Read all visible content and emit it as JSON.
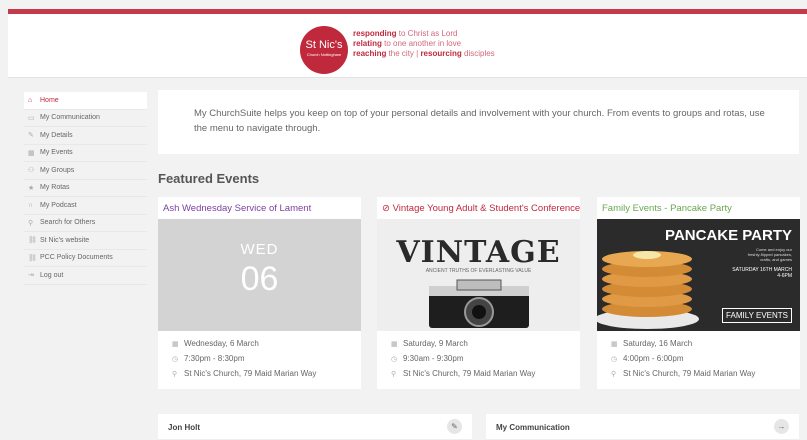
{
  "brand": {
    "logo_text": "St Nic's",
    "logo_sub": "Church Nottingham",
    "colors": {
      "accent": "#c0283c",
      "purple": "#7b3fa0",
      "red": "#c0283c",
      "green": "#6aa84f"
    },
    "tagline": {
      "l1_strong": "responding",
      "l1_rest": " to Christ as Lord",
      "l2_strong": "relating",
      "l2_rest": " to one another in love",
      "l3_strong": "reaching",
      "l3_mid": " the city | ",
      "l3_strong2": "resourcing",
      "l3_rest": " disciples"
    }
  },
  "sidebar": {
    "items": [
      {
        "label": "Home",
        "icon": "home-icon",
        "glyph": "⌂",
        "active": true
      },
      {
        "label": "My Communication",
        "icon": "message-icon",
        "glyph": "▭"
      },
      {
        "label": "My Details",
        "icon": "pencil-icon",
        "glyph": "✎"
      },
      {
        "label": "My Events",
        "icon": "calendar-icon",
        "glyph": "▦"
      },
      {
        "label": "My Groups",
        "icon": "group-icon",
        "glyph": "⚇"
      },
      {
        "label": "My Rotas",
        "icon": "star-icon",
        "glyph": "★"
      },
      {
        "label": "My Podcast",
        "icon": "headphones-icon",
        "glyph": "∩"
      },
      {
        "label": "Search for Others",
        "icon": "search-user-icon",
        "glyph": "⚲"
      },
      {
        "label": "St Nic's website",
        "icon": "link-icon",
        "glyph": "⛓"
      },
      {
        "label": "PCC Policy Documents",
        "icon": "link-icon",
        "glyph": "⛓"
      },
      {
        "label": "Log out",
        "icon": "logout-icon",
        "glyph": "⇥"
      }
    ]
  },
  "intro": {
    "text": "My ChurchSuite helps you keep on top of your personal details and involvement with your church. From events to groups and rotas, use the menu to navigate through."
  },
  "featured": {
    "title": "Featured Events",
    "events": [
      {
        "title": "Ash Wednesday Service of Lament",
        "image": {
          "day": "WED",
          "num": "06"
        },
        "date": "Wednesday, 6 March",
        "time": "7:30pm - 8:30pm",
        "location": "St Nic's Church, 79 Maid Marian Way"
      },
      {
        "title": "Vintage Young Adult & Student's Conference",
        "title_icon": "check-circle-icon",
        "image": {
          "heading": "VINTAGE",
          "sub": "ANCIENT TRUTHS OF EVERLASTING VALUE"
        },
        "date": "Saturday, 9 March",
        "time": "9:30am - 9:30pm",
        "location": "St Nic's Church, 79 Maid Marian Way"
      },
      {
        "title": "Family Events - Pancake Party",
        "image": {
          "heading": "PANCAKE PARTY",
          "sub": "Come and enjoy our freshly-flipped pancakes, crafts, and games",
          "date": "SATURDAY 16TH MARCH",
          "time": "4-6PM",
          "badge": "FAMILY EVENTS"
        },
        "date": "Saturday, 16 March",
        "time": "4:00pm - 6:00pm",
        "location": "St Nic's Church, 79 Maid Marian Way"
      }
    ]
  },
  "panels": {
    "profile_title": "Jon Holt",
    "communication_title": "My Communication"
  }
}
